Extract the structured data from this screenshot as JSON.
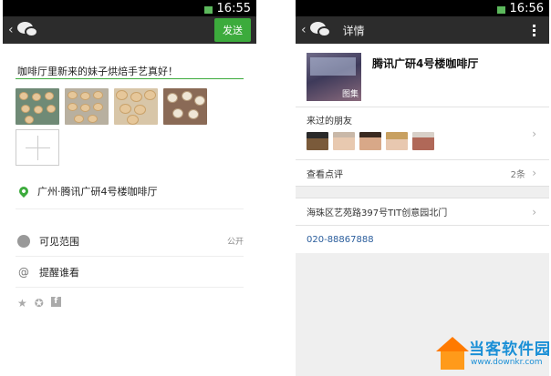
{
  "left_screen": {
    "status_time": "16:55",
    "send_label": "发送",
    "post_text": "咖啡厅里新来的妹子烘焙手艺真好！",
    "location": "广州·腾讯广研4号楼咖啡厅",
    "visibility_label": "可见范围",
    "visibility_value": "公开",
    "mention_label": "提醒谁看",
    "icons": [
      "back-icon",
      "wechat-icon",
      "location-pin-icon",
      "globe-icon",
      "at-icon",
      "star-icon",
      "qzone-icon",
      "facebook-icon"
    ]
  },
  "right_screen": {
    "status_time": "16:56",
    "title": "详情",
    "place_name": "腾讯广研4号楼咖啡厅",
    "thumb_label": "图集",
    "friends_label": "来过的朋友",
    "reviews_label": "查看点评",
    "reviews_count": "2条",
    "address": "海珠区艺苑路397号TIT创意园北门",
    "phone": "020-88867888"
  },
  "watermark": {
    "brand": "当客软件园",
    "url": "www.downkr.com"
  },
  "colors": {
    "accent_green": "#3cab3c",
    "titlebar": "#2c2c2c",
    "link_blue": "#2a5d9c"
  }
}
